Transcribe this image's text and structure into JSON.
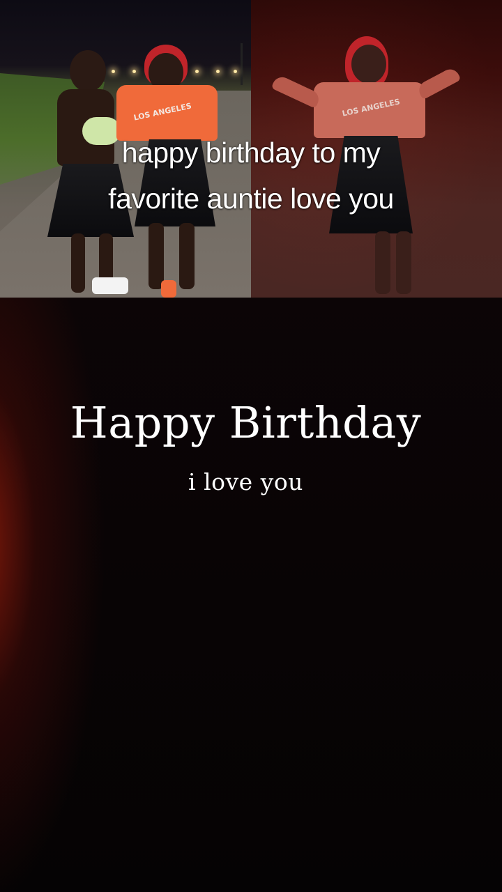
{
  "video": {
    "caption_line_1": "happy birthday to my",
    "caption_line_2": "favorite auntie love you",
    "sweatshirt_print": "LOS ANGELES",
    "sweatshirt_print_right": "LOS ANGELES"
  },
  "card": {
    "title": "Happy Birthday",
    "subtitle": "i love you"
  },
  "colors": {
    "background": "#050304",
    "glow": "#961c0a",
    "text": "#ffffff",
    "sweatshirt": "#f06a3a",
    "hair": "#c0242a"
  }
}
